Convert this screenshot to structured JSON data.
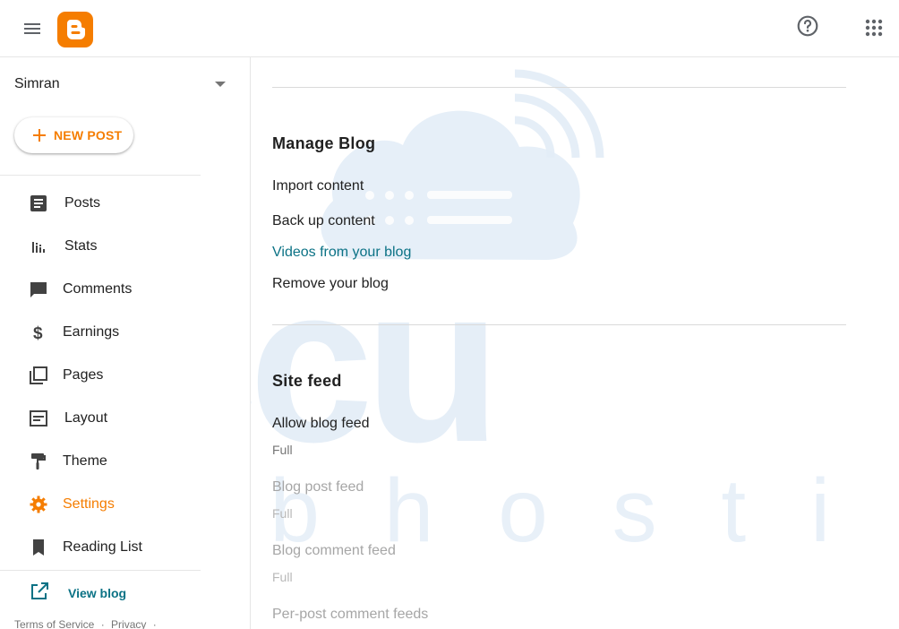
{
  "header": {
    "menu_icon": "hamburger-menu-icon",
    "logo_icon": "blogger-logo-icon",
    "help_icon": "help-icon",
    "apps_icon": "apps-grid-icon",
    "brand_color": "#f57d00"
  },
  "sidebar": {
    "blog_name": "Simran",
    "new_post_label": "NEW POST",
    "items": [
      {
        "label": "Posts",
        "icon": "posts-icon"
      },
      {
        "label": "Stats",
        "icon": "stats-icon"
      },
      {
        "label": "Comments",
        "icon": "comments-icon"
      },
      {
        "label": "Earnings",
        "icon": "dollar-icon"
      },
      {
        "label": "Pages",
        "icon": "pages-icon"
      },
      {
        "label": "Layout",
        "icon": "layout-icon"
      },
      {
        "label": "Theme",
        "icon": "paint-roller-icon"
      },
      {
        "label": "Settings",
        "icon": "gear-icon",
        "active": true
      },
      {
        "label": "Reading List",
        "icon": "bookmark-icon"
      }
    ],
    "view_blog_label": "View blog",
    "footer": {
      "terms": "Terms of Service",
      "sep1": "·",
      "privacy": "Privacy",
      "sep2": "·"
    }
  },
  "main": {
    "manage_blog": {
      "title": "Manage Blog",
      "items": [
        "Import content",
        "Back up content",
        "Videos from your blog",
        "Remove your blog"
      ]
    },
    "site_feed": {
      "title": "Site feed",
      "allow_blog_feed": {
        "label": "Allow blog feed",
        "value": "Full"
      },
      "blog_post_feed": {
        "label": "Blog post feed",
        "value": "Full"
      },
      "blog_comment_feed": {
        "label": "Blog comment feed",
        "value": "Full"
      },
      "per_post_comment_feeds": {
        "label": "Per-post comment feeds"
      }
    }
  },
  "watermark": {
    "brand": "accu",
    "tagline": "w e b  h o s t i n g",
    "color": "#dce9f5"
  },
  "colors": {
    "accent": "#f57d00",
    "link": "#0b7285",
    "text": "#212121",
    "muted": "#757575"
  }
}
